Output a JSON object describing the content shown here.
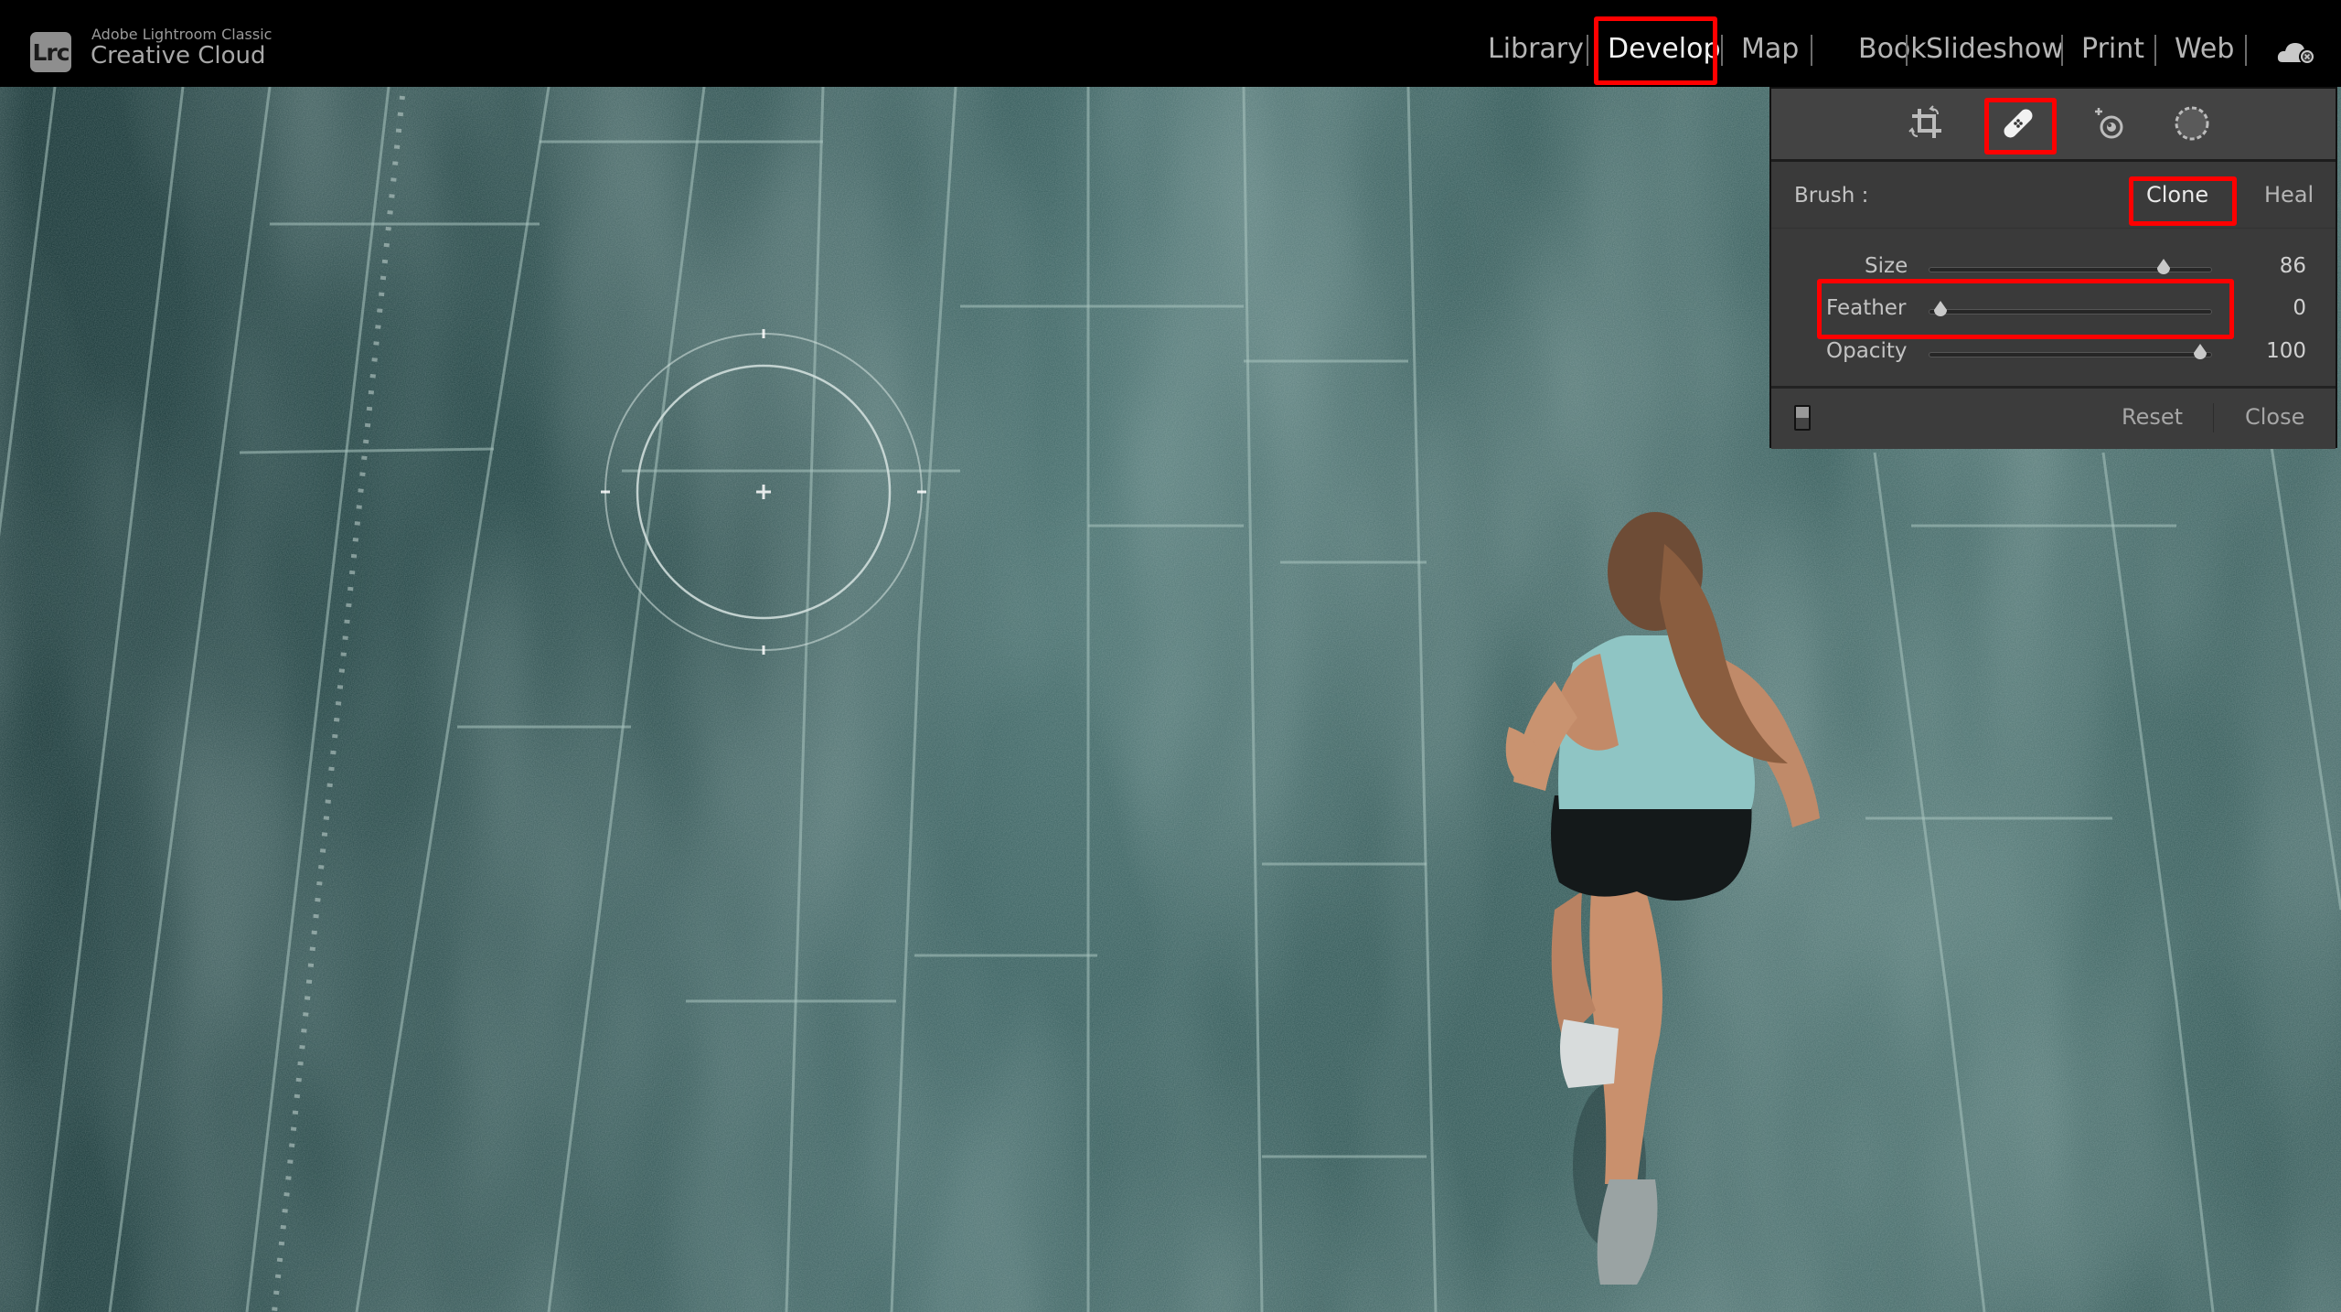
{
  "app": {
    "logo_text": "Lrc",
    "subtitle": "Adobe Lightroom Classic",
    "name": "Creative Cloud"
  },
  "nav": {
    "items": [
      {
        "label": "Library",
        "active": false
      },
      {
        "label": "Develop",
        "active": true
      },
      {
        "label": "Map",
        "active": false
      },
      {
        "label": "Book",
        "active": false
      },
      {
        "label": "Slideshow",
        "active": false
      },
      {
        "label": "Print",
        "active": false
      },
      {
        "label": "Web",
        "active": false
      }
    ],
    "sync_icon": "cloud-sync-paused-icon"
  },
  "tools": [
    {
      "name": "crop-overlay-icon",
      "active": false
    },
    {
      "name": "spot-removal-icon",
      "active": true
    },
    {
      "name": "red-eye-correction-icon",
      "active": false
    },
    {
      "name": "masking-icon",
      "active": false
    }
  ],
  "spot_removal": {
    "brush_label": "Brush :",
    "modes": [
      {
        "label": "Clone",
        "active": true
      },
      {
        "label": "Heal",
        "active": false
      }
    ],
    "sliders": [
      {
        "label": "Size",
        "value": "86",
        "fraction": 0.86,
        "highlighted": false
      },
      {
        "label": "Feather",
        "value": "0",
        "fraction": 0.0,
        "highlighted": true
      },
      {
        "label": "Opacity",
        "value": "100",
        "fraction": 1.0,
        "highlighted": false
      }
    ],
    "reset_label": "Reset",
    "close_label": "Close"
  },
  "annotations": {
    "highlight_color": "#ff0000"
  },
  "canvas": {
    "cursor": "spot-removal-brush-cursor"
  }
}
